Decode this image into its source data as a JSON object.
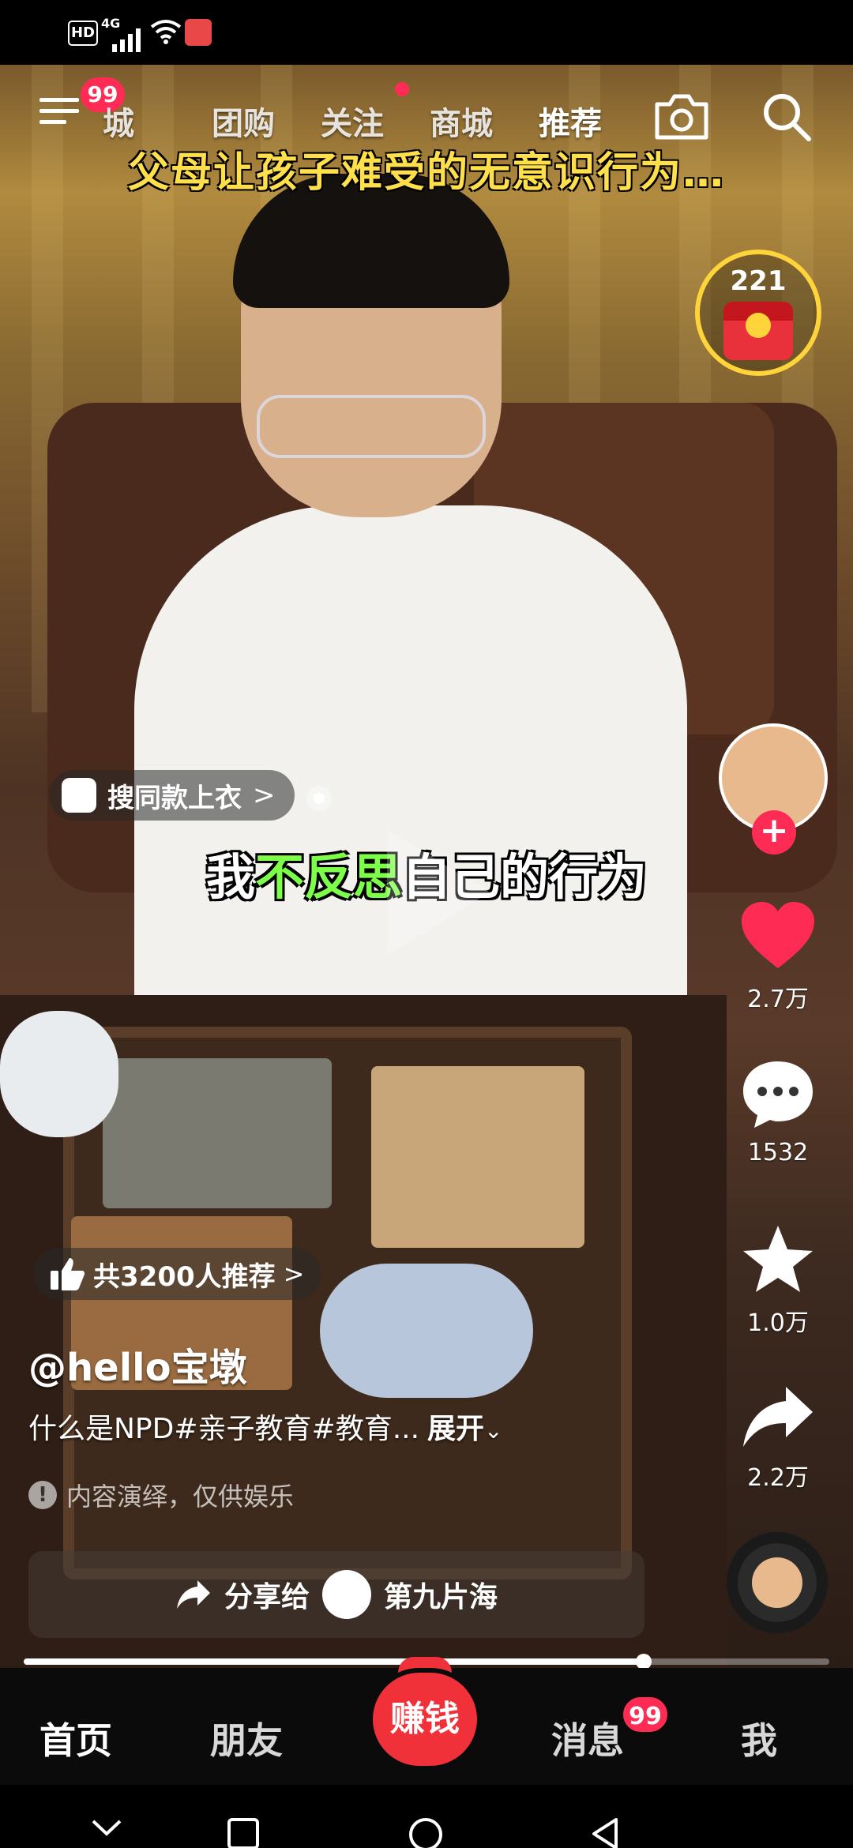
{
  "status_bar": {
    "hd": "HD",
    "network": "4G"
  },
  "top_nav": {
    "menu_badge": "99",
    "tabs": [
      "同城",
      "团购",
      "关注",
      "商城",
      "推荐"
    ],
    "tab_tongcheng_visible": "城"
  },
  "video": {
    "title": "父母让孩子难受的无意识行为…",
    "subtitle_before": "我",
    "subtitle_highlight": "不反思",
    "subtitle_after": "自己的行为",
    "search_chip": "搜同款上衣",
    "chip_arrow": ">"
  },
  "reward": {
    "count": "221"
  },
  "actions": {
    "follow": "+",
    "likes": "2.7万",
    "comments": "1532",
    "collects": "1.0万",
    "shares": "2.2万"
  },
  "info": {
    "recommend": "共3200人推荐",
    "recommend_arrow": ">",
    "author": "@hello宝墩",
    "description": "什么是NPD#亲子教育#教育...",
    "expand": "展开",
    "disclaimer": "内容演绎，仅供娱乐",
    "info_mark": "!"
  },
  "share_bar": {
    "label": "分享给",
    "friend": "第九片海"
  },
  "progress": {
    "fraction": 0.77
  },
  "bottom_tabs": {
    "home": "首页",
    "friends": "朋友",
    "earn": "赚钱",
    "messages": "消息",
    "messages_badge": "99",
    "me": "我"
  },
  "colors": {
    "accent": "#fe2c55",
    "title_yellow": "#ffe04a",
    "highlight_green": "#7dff4a"
  }
}
